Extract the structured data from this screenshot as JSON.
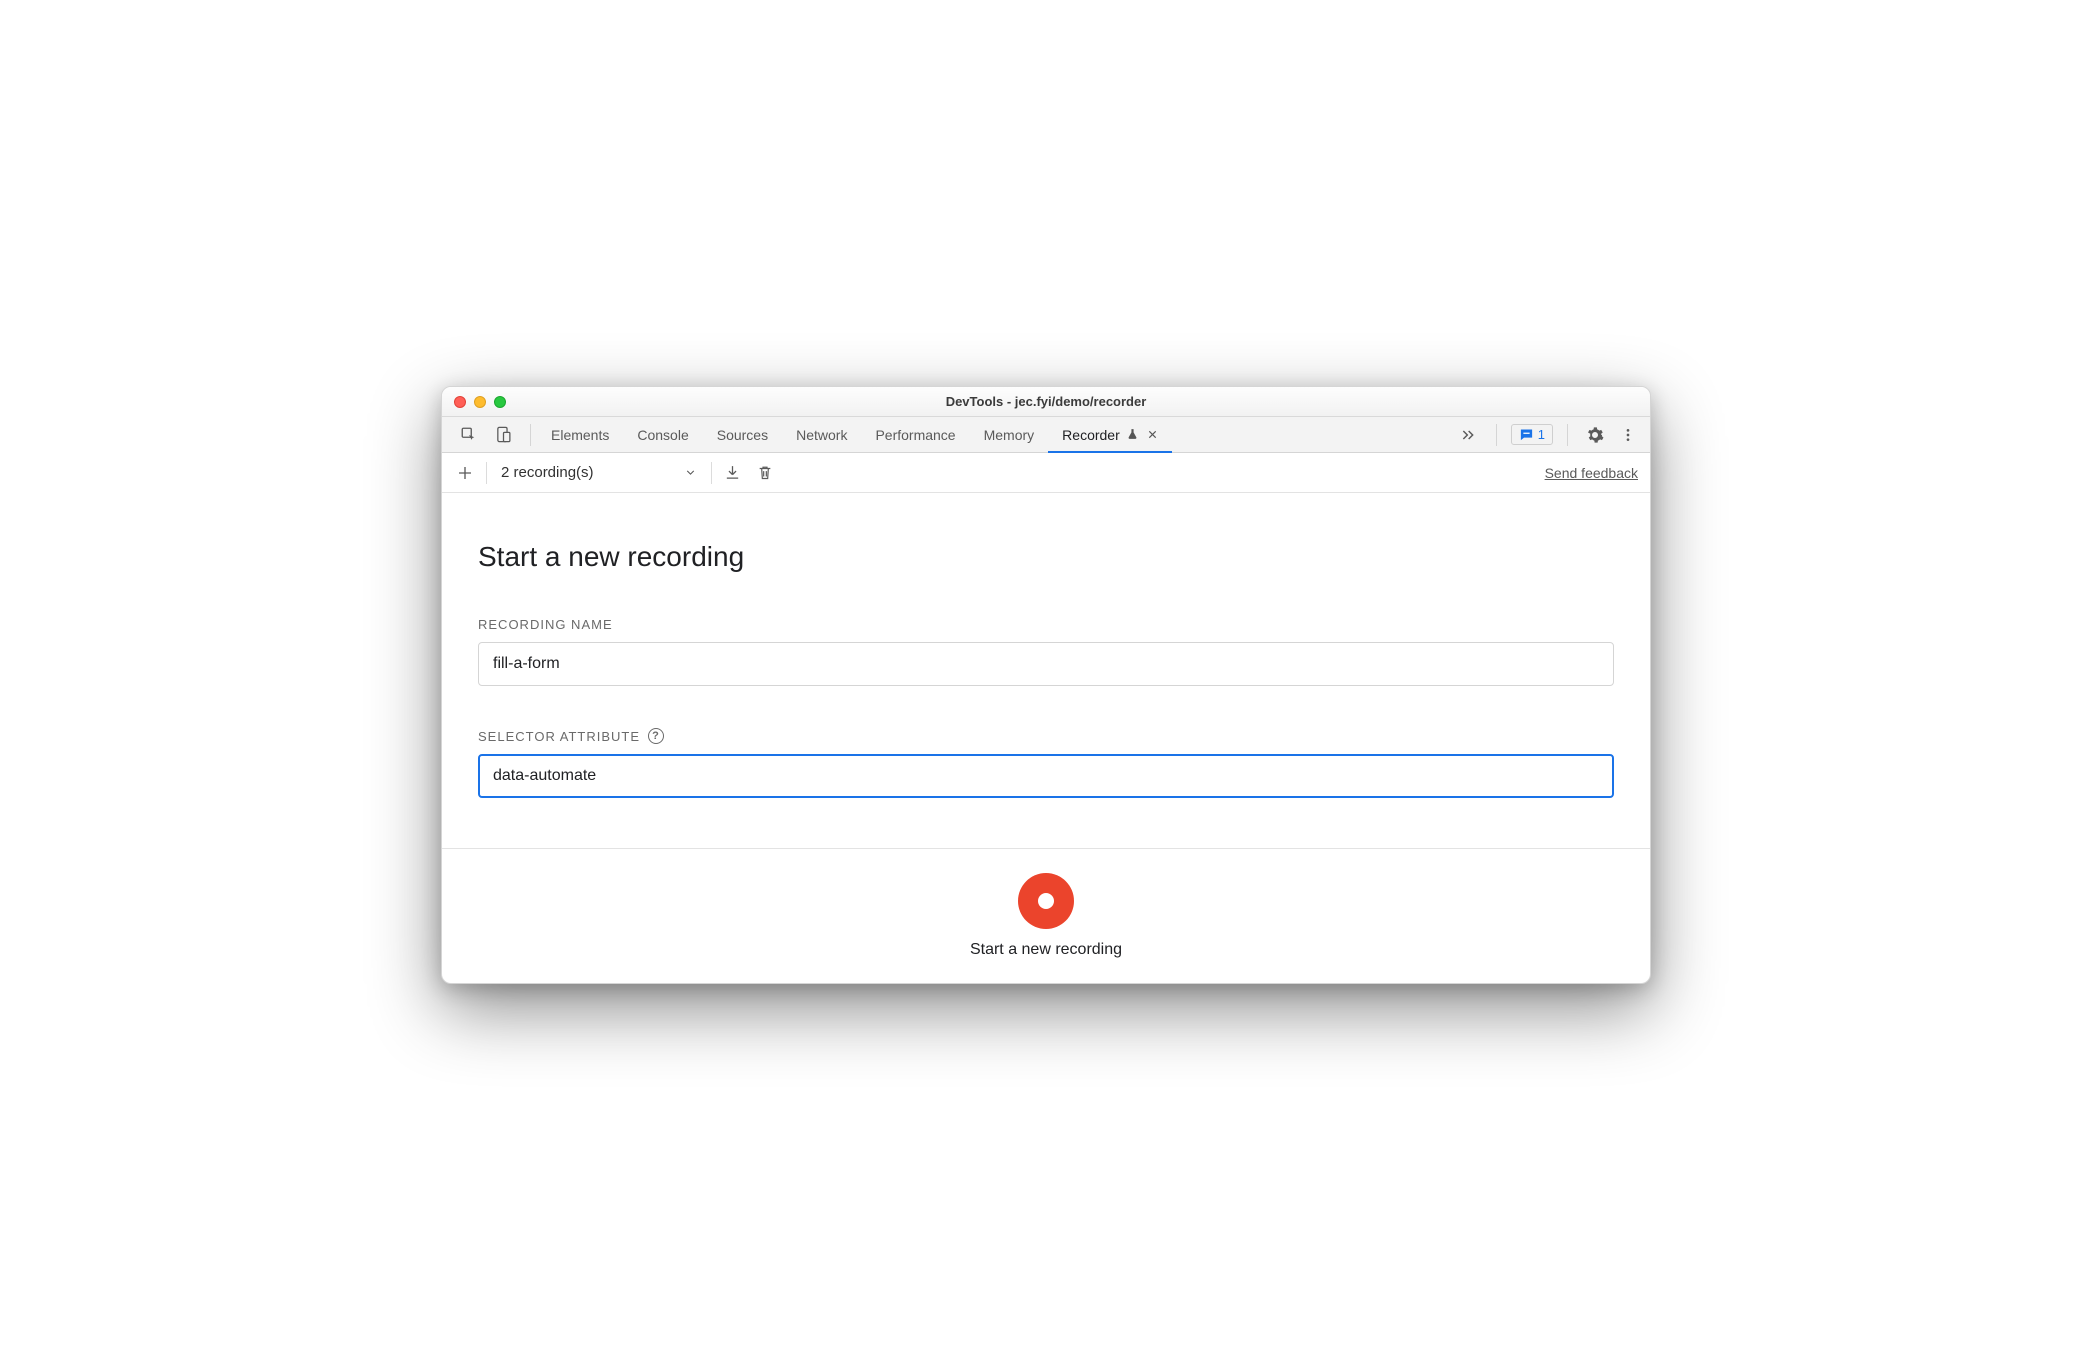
{
  "window": {
    "title": "DevTools - jec.fyi/demo/recorder"
  },
  "tabs": {
    "items": [
      "Elements",
      "Console",
      "Sources",
      "Network",
      "Performance",
      "Memory"
    ],
    "active": {
      "label": "Recorder"
    },
    "issues_count": "1"
  },
  "toolbar": {
    "recordings_label": "2 recording(s)",
    "feedback": "Send feedback"
  },
  "main": {
    "heading": "Start a new recording",
    "recording_name_label": "Recording Name",
    "recording_name_value": "fill-a-form",
    "selector_attr_label": "Selector Attribute",
    "selector_attr_value": "data-automate"
  },
  "footer": {
    "button_label": "Start a new recording"
  }
}
